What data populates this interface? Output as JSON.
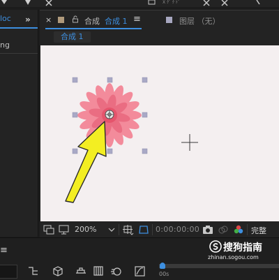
{
  "left_panel": {
    "tab_label": "loc",
    "row_label": "ng",
    "expand_icon": "double-chevron-right-icon"
  },
  "composition_tab": {
    "close_glyph": "×",
    "label": "合成",
    "active_name": "合成 1",
    "menu_glyph": "≡"
  },
  "layer_tab": {
    "label": "图层 （无）"
  },
  "breadcrumb": {
    "label": "合成 1"
  },
  "viewer": {
    "background": "#f4eff0",
    "layer_content": "pink flower",
    "annotation": "yellow arrow pointing to anchor point",
    "crosshair_icon": "crosshair-icon"
  },
  "footer": {
    "zoom": "200%",
    "timecode": "0:00:00:00",
    "quality": "完整"
  },
  "timeline": {
    "menu_glyph": "≡",
    "ruler_label": "00s"
  },
  "watermark": {
    "brand": "搜狗指南",
    "url": "zhinan.sogou.com"
  },
  "colors": {
    "accent": "#3d8fe0",
    "panel": "#232323",
    "arrow": "#f3ee22",
    "flower": "#f0788a",
    "handle": "#a9a9c6"
  }
}
